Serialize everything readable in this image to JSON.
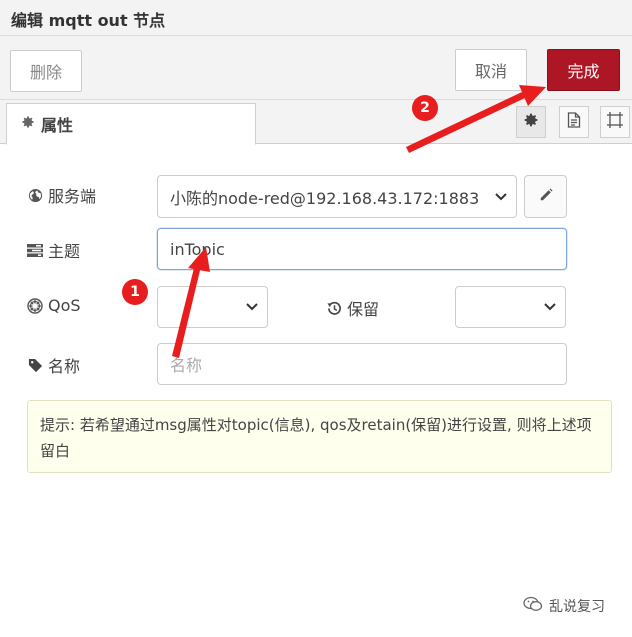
{
  "dialog": {
    "title": "编辑 mqtt out 节点"
  },
  "toolbar": {
    "delete_label": "删除",
    "cancel_label": "取消",
    "done_label": "完成"
  },
  "tabs": {
    "properties_label": "属性",
    "icons": [
      "gear-icon",
      "file-text-icon",
      "frame-icon"
    ]
  },
  "form": {
    "server": {
      "label": "服务端",
      "value": "小陈的node-red@192.168.43.172:1883"
    },
    "topic": {
      "label": "主题",
      "value": "inTopic"
    },
    "qos": {
      "label": "QoS",
      "value": ""
    },
    "retain": {
      "label": "保留",
      "value": ""
    },
    "name": {
      "label": "名称",
      "placeholder": "名称",
      "value": ""
    }
  },
  "tip": {
    "text": "提示: 若希望通过msg属性对topic(信息), qos及retain(保留)进行设置, 则将上述项留白"
  },
  "annotations": {
    "badge_1": "1",
    "badge_2": "2",
    "color": "#e81d1d"
  },
  "watermark": {
    "text": "乱说复习"
  },
  "colors": {
    "accent": "#ad1625",
    "tip_background": "#ffffee",
    "focus_border": "#7fa6d6"
  }
}
